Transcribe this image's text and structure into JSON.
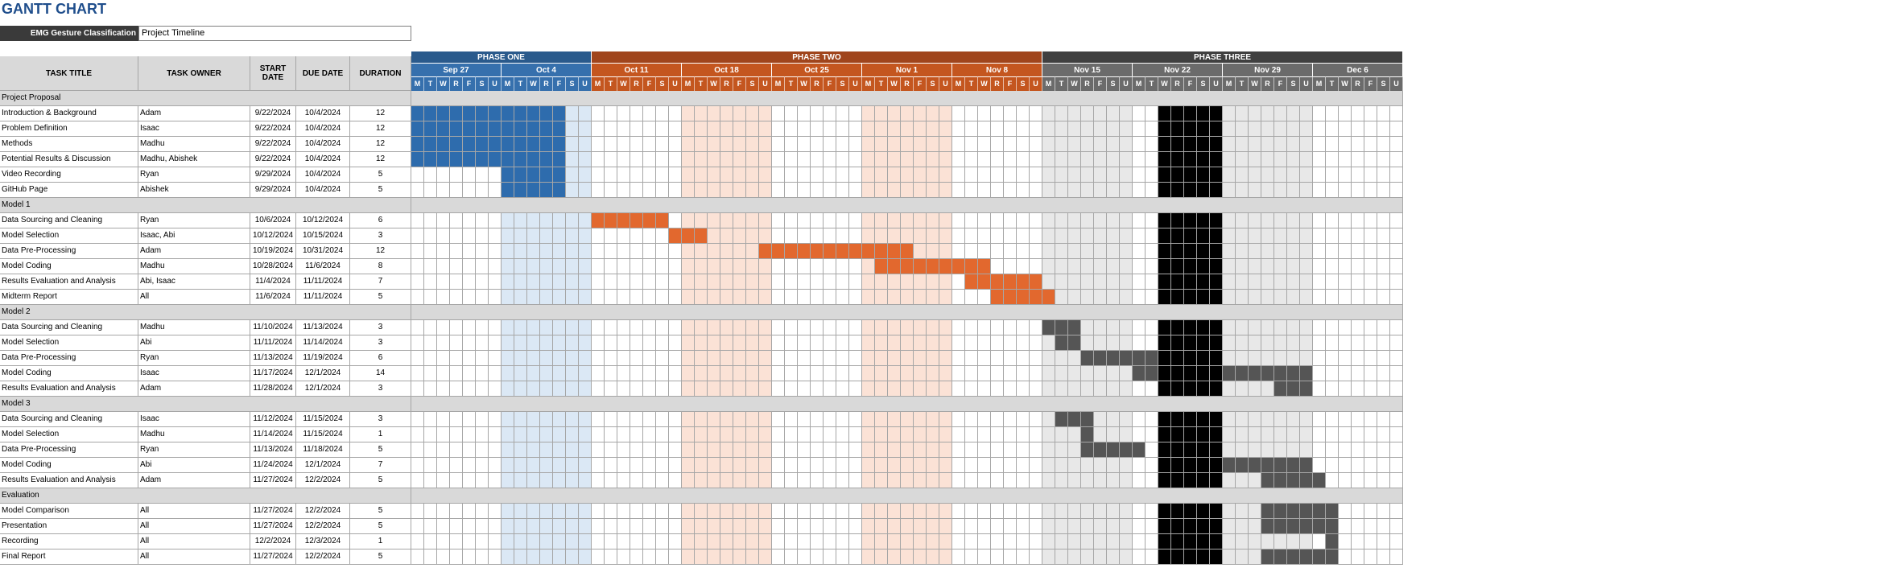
{
  "title": "GANTT CHART",
  "project": {
    "label": "EMG Gesture Classification",
    "name": "Project Timeline"
  },
  "columns": {
    "task": "TASK TITLE",
    "owner": "TASK OWNER",
    "start": "START DATE",
    "due": "DUE DATE",
    "duration": "DURATION"
  },
  "colors": {
    "phase1": "#2a5a8c",
    "phase1_week": "#3670ad",
    "phase1_bar": "#2e6cad",
    "phase1_weekend": "#dbe8f5",
    "phase2": "#a0451c",
    "phase2_week": "#c4561f",
    "phase2_bar": "#e2682e",
    "phase2_alt": "#fbe2d6",
    "phase3": "#404040",
    "phase3_week": "#6b6b6b",
    "phase3_bar": "#555555",
    "phase3_alt": "#e8e8e8",
    "blackout": "#000000",
    "section": "#d9d9d9"
  },
  "phases": [
    {
      "label": "PHASE ONE",
      "start": 0,
      "days": 14,
      "color": "#2a5a8c"
    },
    {
      "label": "PHASE TWO",
      "start": 14,
      "days": 35,
      "color": "#a0451c"
    },
    {
      "label": "PHASE THREE",
      "start": 49,
      "days": 28,
      "color": "#404040"
    }
  ],
  "weeks": [
    "Sep 27",
    "Oct 4",
    "Oct 11",
    "Oct 18",
    "Oct 25",
    "Nov 1",
    "Nov 8",
    "Nov 15",
    "Nov 22",
    "Nov 29",
    "Dec 6"
  ],
  "day_letters": [
    "M",
    "T",
    "W",
    "R",
    "F",
    "S",
    "U"
  ],
  "rows": [
    {
      "type": "section",
      "title": "Project Proposal"
    },
    {
      "title": "Introduction & Background",
      "owner": "Adam",
      "start": "9/22/2024",
      "due": "10/4/2024",
      "dur": "12",
      "bar": [
        0,
        12
      ],
      "phase": 1
    },
    {
      "title": "Problem Definition",
      "owner": "Isaac",
      "start": "9/22/2024",
      "due": "10/4/2024",
      "dur": "12",
      "bar": [
        0,
        12
      ],
      "phase": 1
    },
    {
      "title": "Methods",
      "owner": "Madhu",
      "start": "9/22/2024",
      "due": "10/4/2024",
      "dur": "12",
      "bar": [
        0,
        12
      ],
      "phase": 1
    },
    {
      "title": "Potential Results & Discussion",
      "owner": "Madhu, Abishek",
      "start": "9/22/2024",
      "due": "10/4/2024",
      "dur": "12",
      "bar": [
        0,
        12
      ],
      "phase": 1
    },
    {
      "title": "Video Recording",
      "owner": "Ryan",
      "start": "9/29/2024",
      "due": "10/4/2024",
      "dur": "5",
      "bar": [
        7,
        12
      ],
      "phase": 1
    },
    {
      "title": "GitHub Page",
      "owner": "Abishek",
      "start": "9/29/2024",
      "due": "10/4/2024",
      "dur": "5",
      "bar": [
        7,
        12
      ],
      "phase": 1
    },
    {
      "type": "section",
      "title": "Model 1"
    },
    {
      "title": "Data Sourcing and Cleaning",
      "owner": "Ryan",
      "start": "10/6/2024",
      "due": "10/12/2024",
      "dur": "6",
      "bar": [
        14,
        20
      ],
      "phase": 2
    },
    {
      "title": "Model Selection",
      "owner": "Isaac, Abi",
      "start": "10/12/2024",
      "due": "10/15/2024",
      "dur": "3",
      "bar": [
        20,
        23
      ],
      "phase": 2
    },
    {
      "title": "Data Pre-Processing",
      "owner": "Adam",
      "start": "10/19/2024",
      "due": "10/31/2024",
      "dur": "12",
      "bar": [
        27,
        39
      ],
      "phase": 2
    },
    {
      "title": "Model Coding",
      "owner": "Madhu",
      "start": "10/28/2024",
      "due": "11/6/2024",
      "dur": "8",
      "bar": [
        36,
        45
      ],
      "phase": 2
    },
    {
      "title": "Results Evaluation and Analysis",
      "owner": "Abi, Isaac",
      "start": "11/4/2024",
      "due": "11/11/2024",
      "dur": "7",
      "bar": [
        43,
        49
      ],
      "phase": 2
    },
    {
      "title": "Midterm Report",
      "owner": "All",
      "start": "11/6/2024",
      "due": "11/11/2024",
      "dur": "5",
      "bar": [
        45,
        50
      ],
      "phase": 2
    },
    {
      "type": "section",
      "title": "Model 2"
    },
    {
      "title": "Data Sourcing and Cleaning",
      "owner": "Madhu",
      "start": "11/10/2024",
      "due": "11/13/2024",
      "dur": "3",
      "bar": [
        49,
        52
      ],
      "phase": 3
    },
    {
      "title": "Model Selection",
      "owner": "Abi",
      "start": "11/11/2024",
      "due": "11/14/2024",
      "dur": "3",
      "bar": [
        50,
        52
      ],
      "phase": 3
    },
    {
      "title": "Data Pre-Processing",
      "owner": "Ryan",
      "start": "11/13/2024",
      "due": "11/19/2024",
      "dur": "6",
      "bar": [
        52,
        58
      ],
      "phase": 3
    },
    {
      "title": "Model Coding",
      "owner": "Isaac",
      "start": "11/17/2024",
      "due": "12/1/2024",
      "dur": "14",
      "bar": [
        56,
        70
      ],
      "phase": 3
    },
    {
      "title": "Results Evaluation and Analysis",
      "owner": "Adam",
      "start": "11/28/2024",
      "due": "12/1/2024",
      "dur": "3",
      "bar": [
        67,
        70
      ],
      "phase": 3
    },
    {
      "type": "section",
      "title": "Model 3"
    },
    {
      "title": "Data Sourcing and Cleaning",
      "owner": "Isaac",
      "start": "11/12/2024",
      "due": "11/15/2024",
      "dur": "3",
      "bar": [
        50,
        53
      ],
      "phase": 3
    },
    {
      "title": "Model Selection",
      "owner": "Madhu",
      "start": "11/14/2024",
      "due": "11/15/2024",
      "dur": "1",
      "bar": [
        52,
        53
      ],
      "phase": 3
    },
    {
      "title": "Data Pre-Processing",
      "owner": "Ryan",
      "start": "11/13/2024",
      "due": "11/18/2024",
      "dur": "5",
      "bar": [
        52,
        57
      ],
      "phase": 3
    },
    {
      "title": "Model Coding",
      "owner": "Abi",
      "start": "11/24/2024",
      "due": "12/1/2024",
      "dur": "7",
      "bar": [
        63,
        70
      ],
      "phase": 3
    },
    {
      "title": "Results Evaluation and Analysis",
      "owner": "Adam",
      "start": "11/27/2024",
      "due": "12/2/2024",
      "dur": "5",
      "bar": [
        66,
        71
      ],
      "phase": 3
    },
    {
      "type": "section",
      "title": "Evaluation"
    },
    {
      "title": "Model Comparison",
      "owner": "All",
      "start": "11/27/2024",
      "due": "12/2/2024",
      "dur": "5",
      "bar": [
        66,
        72
      ],
      "phase": 3
    },
    {
      "title": "Presentation",
      "owner": "All",
      "start": "11/27/2024",
      "due": "12/2/2024",
      "dur": "5",
      "bar": [
        66,
        72
      ],
      "phase": 3
    },
    {
      "title": "Recording",
      "owner": "All",
      "start": "12/2/2024",
      "due": "12/3/2024",
      "dur": "1",
      "bar": [
        71,
        72
      ],
      "phase": 3
    },
    {
      "title": "Final Report",
      "owner": "All",
      "start": "11/27/2024",
      "due": "12/2/2024",
      "dur": "5",
      "bar": [
        66,
        72
      ],
      "phase": 3
    }
  ]
}
